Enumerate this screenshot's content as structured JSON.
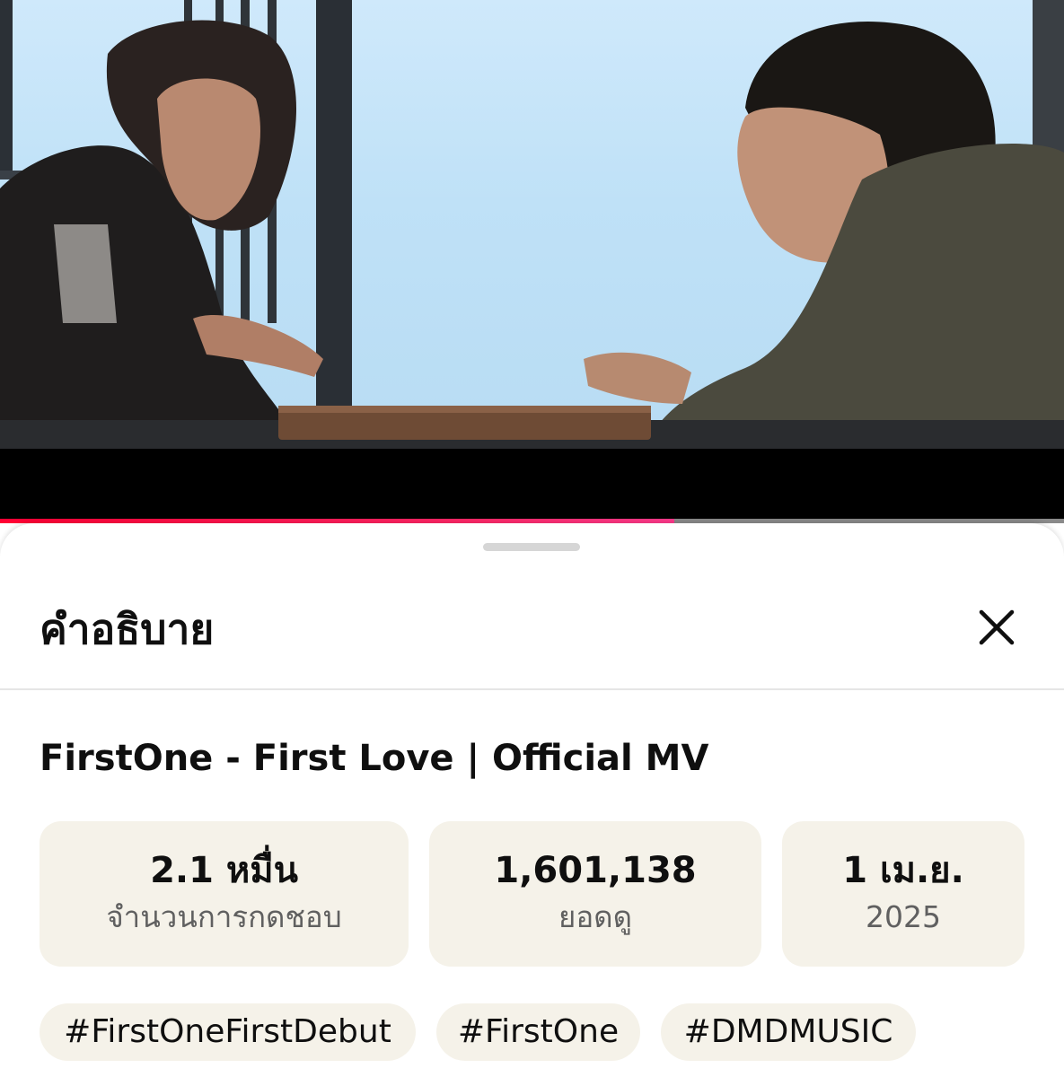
{
  "player": {
    "progress_fraction": 0.634,
    "progress_color": "#ff0033"
  },
  "panel": {
    "title": "คำอธิบาย",
    "close_icon": "close-icon"
  },
  "video": {
    "title": "FirstOne - First Love | Official MV"
  },
  "stats": {
    "likes": {
      "value": "2.1 หมื่น",
      "label": "จำนวนการกดชอบ"
    },
    "views": {
      "value": "1,601,138",
      "label": "ยอดดู"
    },
    "date": {
      "value": "1 เม.ย.",
      "label": "2025"
    }
  },
  "hashtags": [
    "#FirstOneFirstDebut",
    "#FirstOne",
    "#DMDMUSIC"
  ]
}
